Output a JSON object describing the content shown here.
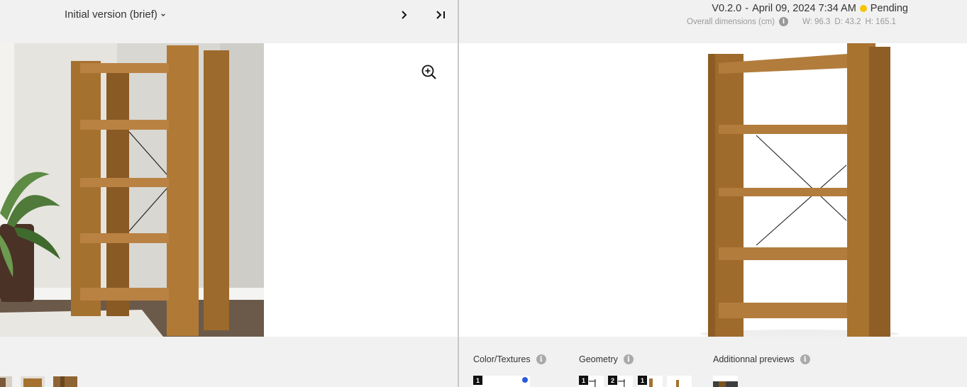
{
  "left": {
    "version_label": "Initial version (brief)",
    "icons": {
      "dropdown": "chevron-down-icon",
      "next": "chevron-right-icon",
      "last": "skip-to-end-icon",
      "zoom": "zoom-in-icon"
    }
  },
  "right": {
    "version": "V0.2.0",
    "separator": "-",
    "date": "April 09, 2024 7:34 AM",
    "status": "Pending",
    "status_color": "#f5c400",
    "dims_label": "Overall dimensions (cm)",
    "width": "W: 96.3",
    "depth": "D: 43.2",
    "height": "H: 165.1",
    "sections": {
      "color_textures": "Color/Textures",
      "geometry": "Geometry",
      "additional_previews": "Additionnal previews"
    },
    "tile_numbers": {
      "color1": "1",
      "geom1": "1",
      "geom2": "2",
      "geom3": "1"
    }
  },
  "colors": {
    "wood": "#a5712f",
    "wood_dark": "#7d5220",
    "accent_blue": "#2a5bd7",
    "background": "#f1f1f1"
  }
}
